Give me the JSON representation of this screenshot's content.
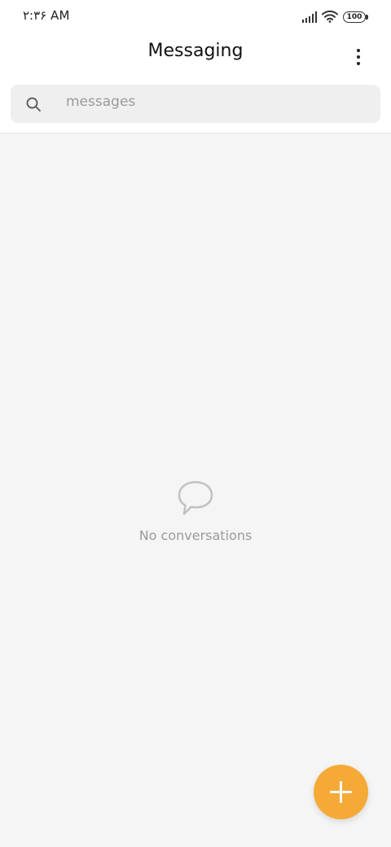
{
  "status_bar": {
    "time": "۲:۳۶ AM",
    "battery": "100",
    "signal_icon": "signal-icon",
    "wifi_icon": "wifi-icon"
  },
  "header": {
    "title": "Messaging",
    "more_icon": "more-vertical-icon"
  },
  "search": {
    "placeholder": "messages",
    "icon": "search-icon"
  },
  "empty_state": {
    "icon": "chat-bubble-icon",
    "text": "No conversations"
  },
  "fab": {
    "icon": "plus-icon",
    "color": "#F5AA37"
  },
  "colors": {
    "background": "#F5F5F5",
    "header_background": "#FFFFFF",
    "search_background": "#EFEFEF",
    "accent": "#F5AA37"
  }
}
